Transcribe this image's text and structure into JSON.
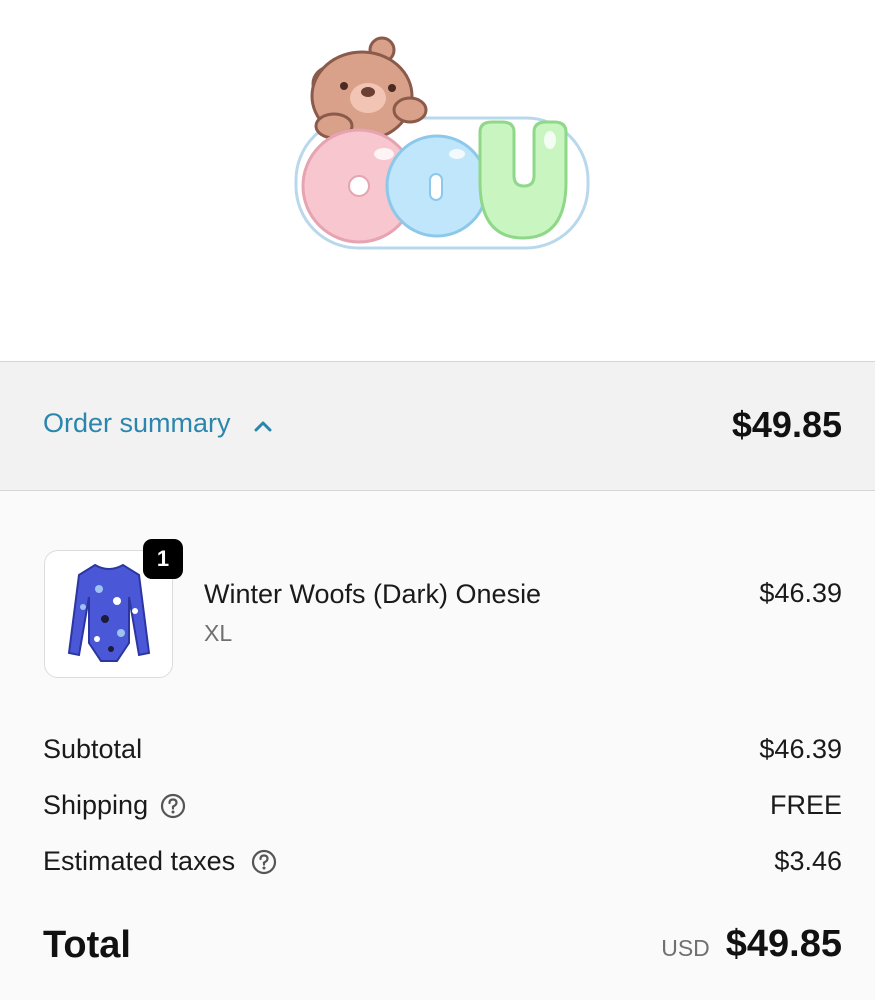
{
  "header": {
    "logo_alt": "ODU"
  },
  "summary_toggle": {
    "label": "Order summary",
    "total": "$49.85"
  },
  "line_item": {
    "quantity": "1",
    "name": "Winter Woofs (Dark) Onesie",
    "variant": "XL",
    "price": "$46.39"
  },
  "totals": {
    "subtotal_label": "Subtotal",
    "subtotal_value": "$46.39",
    "shipping_label": "Shipping",
    "shipping_value": "FREE",
    "taxes_label": "Estimated taxes",
    "taxes_value": "$3.46",
    "total_label": "Total",
    "currency": "USD",
    "total_value": "$49.85"
  },
  "colors": {
    "link": "#2b86ad",
    "toggle_bg": "#f2f2f2",
    "body_bg": "#fafafa",
    "badge_bg": "#000000",
    "logo_pink": "#f7c6cf",
    "logo_blue": "#bfe6fb",
    "logo_green": "#c9f5c0",
    "bear_brown": "#d9a08a"
  },
  "icons": {
    "chevron": "chevron-up-icon",
    "help": "question-circle-icon"
  }
}
